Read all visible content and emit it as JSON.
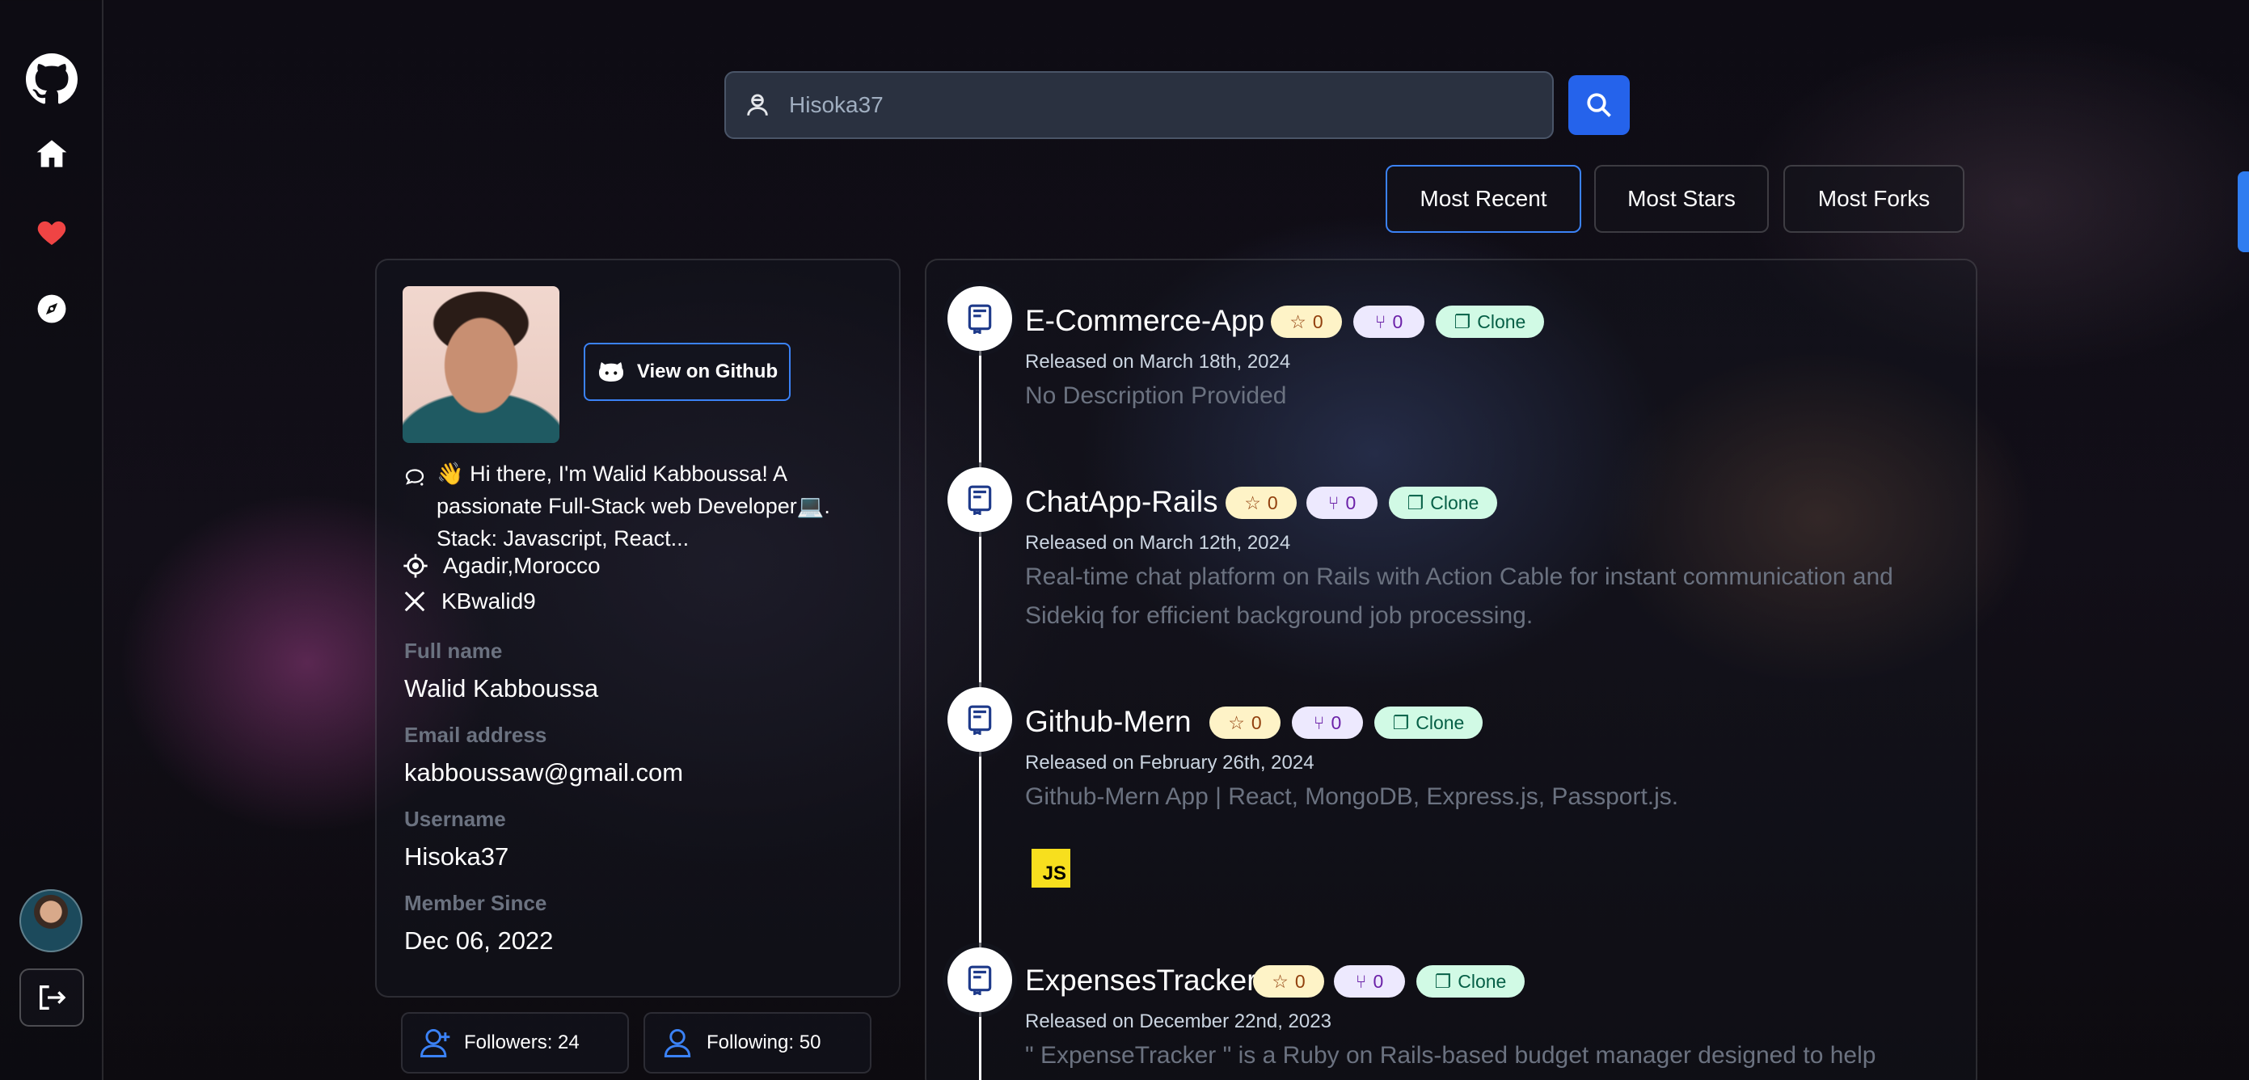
{
  "search": {
    "value": "Hisoka37"
  },
  "sort_buttons": [
    "Most Recent",
    "Most Stars",
    "Most Forks"
  ],
  "profile": {
    "view_github_label": "View on Github",
    "bio": "👋 Hi there, I'm Walid Kabboussa! A passionate Full-Stack web Developer💻. Stack: Javascript, React...",
    "location": "Agadir,Morocco",
    "twitter": "KBwalid9",
    "fields": [
      {
        "label": "Full name",
        "value": "Walid Kabboussa"
      },
      {
        "label": "Email address",
        "value": "kabboussaw@gmail.com"
      },
      {
        "label": "Username",
        "value": "Hisoka37"
      },
      {
        "label": "Member Since",
        "value": "Dec 06, 2022"
      }
    ],
    "followers": "Followers: 24",
    "following": "Following: 50"
  },
  "repos": [
    {
      "name": "E-Commerce-App",
      "stars": "0",
      "forks": "0",
      "clone_label": "Clone",
      "released": "Released on March 18th, 2024",
      "description": "No Description Provided"
    },
    {
      "name": "ChatApp-Rails",
      "stars": "0",
      "forks": "0",
      "clone_label": "Clone",
      "released": "Released on March 12th, 2024",
      "description": "Real-time chat platform on Rails with Action Cable for instant communication and Sidekiq for efficient background job processing."
    },
    {
      "name": "Github-Mern",
      "stars": "0",
      "forks": "0",
      "clone_label": "Clone",
      "released": "Released on February 26th, 2024",
      "description": "Github-Mern App | React, MongoDB, Express.js, Passport.js.",
      "language_logo": "JS"
    },
    {
      "name": "ExpensesTracker",
      "stars": "0",
      "forks": "0",
      "clone_label": "Clone",
      "released": "Released on December 22nd, 2023",
      "description": "\" ExpenseTracker \" is a Ruby on Rails-based budget manager designed to help"
    }
  ],
  "colors": {
    "accent": "#2563eb",
    "border_active": "#3b82f6",
    "heart": "#ef4444"
  },
  "icons": {
    "sidebar": [
      "github-logo-icon",
      "home-icon",
      "heart-icon",
      "compass-icon",
      "user-avatar",
      "logout-icon"
    ],
    "search": [
      "user-icon",
      "search-icon"
    ],
    "repo": "repo-book-icon"
  }
}
